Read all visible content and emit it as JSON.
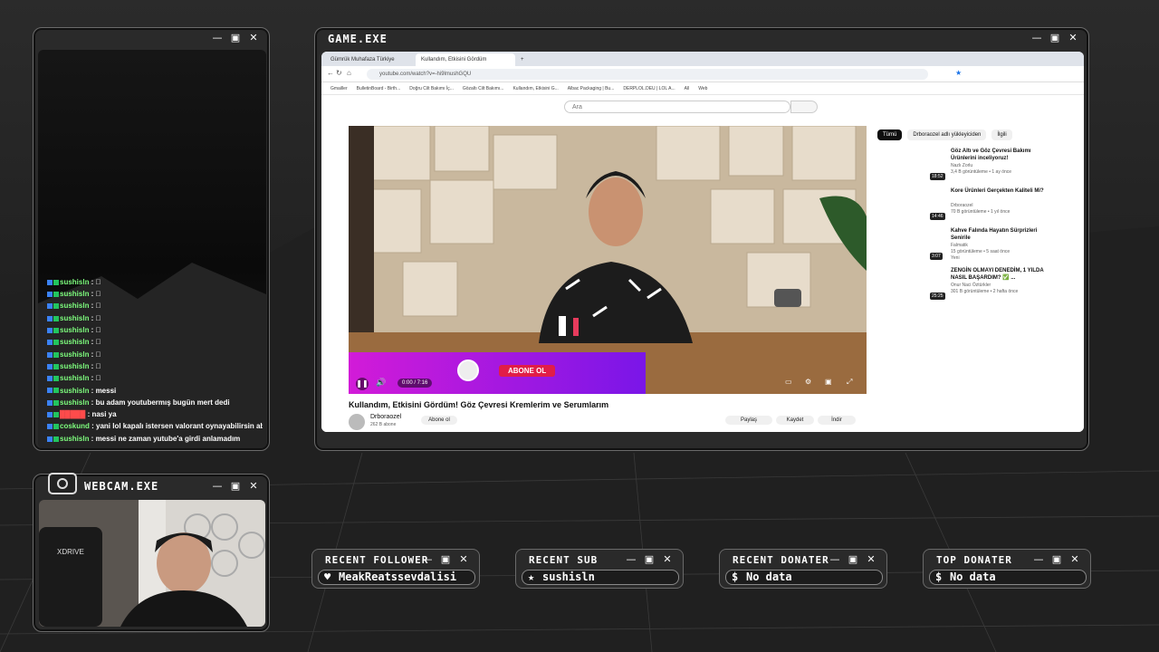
{
  "chat": {
    "lines": [
      {
        "user": "sushisln",
        "msg": "🏿"
      },
      {
        "user": "sushisln",
        "msg": "🏿"
      },
      {
        "user": "sushisln",
        "msg": "🏿"
      },
      {
        "user": "sushisln",
        "msg": "🏿"
      },
      {
        "user": "sushisln",
        "msg": "🏿"
      },
      {
        "user": "sushisln",
        "msg": "🏿"
      },
      {
        "user": "sushisln",
        "msg": "🏿"
      },
      {
        "user": "sushisln",
        "msg": "🏿"
      },
      {
        "user": "sushisln",
        "msg": "🏿"
      },
      {
        "user": "sushisln",
        "msg": "messi"
      },
      {
        "user": "sushisln",
        "msg": "bu adam youtubermış bugün mert dedi"
      },
      {
        "user": "█████",
        "msg": "nasi ya",
        "color": "#ff4b4b"
      },
      {
        "user": "coskund",
        "msg": "yani lol kapalı istersen valorant oynayabilirsin ablaların güllü"
      },
      {
        "user": "sushisln",
        "msg": "messi ne zaman yutube'a girdi anlamadım"
      }
    ]
  },
  "game_window": {
    "title": "GAME.EXE"
  },
  "webcam_window": {
    "title": "WEBCAM.EXE"
  },
  "browser": {
    "tabs": [
      {
        "label": "Gümrük Muhafaza Türkiye"
      },
      {
        "label": "Kullandım, Etkisini Gördüm"
      }
    ],
    "url": "youtube.com/watch?v=-hi9lmushGQU",
    "bookmarks": [
      "Gmailler",
      "BulletinBoard - Birth...",
      "Doğru Cilt Bakımı İç...",
      "Gözaltı Cilt Bakımı...",
      "Kullandım, Etkisini G...",
      "Albac Packaging | Bu...",
      "DERPLOL.DEU | LOL A...",
      "All",
      "Web"
    ],
    "search_placeholder": "Ara",
    "video": {
      "title": "Kullandım, Etkisini Gördüm! Göz Çevresi Kremlerim ve Serumlarım",
      "channel": "Drboraozel",
      "subscribers": "262 B abone",
      "subscribe_label": "Abone ol",
      "time": "0:00 / 7:16",
      "overlay_subscribe": "ABONE OL",
      "share_label": "Paylaş",
      "save_label": "Kaydet",
      "download_label": "İndir"
    },
    "filter_chips": [
      "Tümü",
      "Drboraozel adlı yükleyiciden",
      "İlgili"
    ],
    "recommendations": [
      {
        "title": "Göz Altı ve Göz Çevresi Bakımı Ürünlerini inceliyoruz!",
        "channel": "Nazlı Zorlu",
        "meta": "3,4 B görüntüleme • 1 ay önce",
        "duration": "18:52"
      },
      {
        "title": "Kore Ürünleri Gerçekten Kaliteli Mi?",
        "channel": "Drboraozel",
        "meta": "70 B görüntüleme • 1 yıl önce",
        "duration": "14:46"
      },
      {
        "title": "Kahve Falında Hayatın Sürprizleri Senirile",
        "channel": "Falmatik",
        "meta": "15 görüntüleme • 5 saat önce",
        "badge": "Yeni",
        "duration": "3:07"
      },
      {
        "title": "ZENGİN OLMAYI DENEDİM, 1 YILDA NASIL BAŞARDIM? ✅ ...",
        "channel": "Onur Naci Öztürkler",
        "meta": "301 B görüntüleme • 2 hafta önce",
        "duration": "25:25"
      }
    ]
  },
  "widgets": {
    "recent_follower": {
      "title": "RECENT FOLLOWER",
      "value": "MeakReatssevdalisi",
      "icon": "heart-icon"
    },
    "recent_sub": {
      "title": "RECENT SUB",
      "value": "sushisln",
      "icon": "star-icon"
    },
    "recent_donater": {
      "title": "RECENT DONATER",
      "value": "No data",
      "icon": "dollar-icon"
    },
    "top_donater": {
      "title": "TOP DONATER",
      "value": "No data",
      "icon": "dollar-icon"
    }
  },
  "colors": {
    "accent": "#ff0000",
    "overlay_magenta": "#d21bd8",
    "overlay_purple": "#7a16e8",
    "chat_name": "#7dfc7d"
  }
}
